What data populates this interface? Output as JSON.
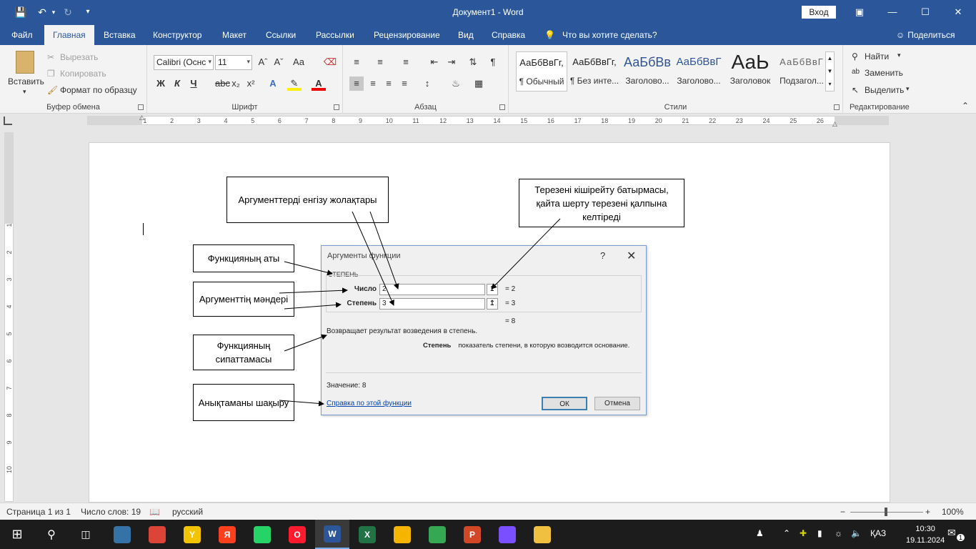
{
  "window": {
    "title": "Документ1 - Word",
    "signin": "Вход",
    "qat": [
      "save-icon",
      "undo-icon",
      "redo-icon",
      "customize-icon"
    ]
  },
  "tabs": [
    "Файл",
    "Главная",
    "Вставка",
    "Конструктор",
    "Макет",
    "Ссылки",
    "Рассылки",
    "Рецензирование",
    "Вид",
    "Справка"
  ],
  "active_tab": "Главная",
  "tellme": "Что вы хотите сделать?",
  "share": "Поделиться",
  "ribbon": {
    "clipboard": {
      "paste": "Вставить",
      "cut": "Вырезать",
      "copy": "Копировать",
      "format_painter": "Формат по образцу",
      "label": "Буфер обмена"
    },
    "font": {
      "name": "Calibri (Оснс",
      "size": "11",
      "label": "Шрифт",
      "bold": "Ж",
      "italic": "К",
      "underline": "Ч",
      "sub": "x₂",
      "sup": "x²",
      "grow": "A^",
      "shrink": "Aˇ",
      "case": "Aa"
    },
    "paragraph": {
      "label": "Абзац",
      "pilcrow": "¶"
    },
    "styles": {
      "label": "Стили",
      "items": [
        {
          "sample": "АаБбВвГг,",
          "name": "¶ Обычный"
        },
        {
          "sample": "АаБбВвГг,",
          "name": "¶ Без инте..."
        },
        {
          "sample": "АаБбВв",
          "name": "Заголово..."
        },
        {
          "sample": "АаБбВвГ",
          "name": "Заголово..."
        },
        {
          "sample": "АаЬ",
          "name": "Заголовок"
        },
        {
          "sample": "АаБбВвГ",
          "name": "Подзагол..."
        }
      ]
    },
    "editing": {
      "find": "Найти",
      "replace": "Заменить",
      "select": "Выделить",
      "label": "Редактирование"
    }
  },
  "ruler": {
    "h_numbers": [
      "2",
      "1",
      "1",
      "2",
      "3",
      "4",
      "5",
      "6",
      "7",
      "8",
      "9",
      "10",
      "11",
      "12",
      "13",
      "14",
      "15",
      "16",
      "17",
      "18",
      "19",
      "20",
      "21",
      "22",
      "23",
      "24",
      "25",
      "26",
      "27"
    ],
    "v_numbers": [
      "3",
      "2",
      "1",
      "1",
      "2",
      "3",
      "4",
      "5",
      "6",
      "7",
      "8",
      "9",
      "10"
    ]
  },
  "dialog": {
    "title": "Аргументы функции",
    "help": "?",
    "close": "✕",
    "function_name": "СТЕПЕНЬ",
    "args": [
      {
        "label": "Число",
        "value": "2",
        "result": "=   2"
      },
      {
        "label": "Степень",
        "value": "3",
        "result": "=   3"
      }
    ],
    "total": "=   8",
    "description": "Возвращает результат возведения в степень.",
    "arg_desc_label": "Степень",
    "arg_desc_text": "показатель степени, в которую возводится основание.",
    "value_line": "Значение:   8",
    "help_link": "Справка по этой функции",
    "ok": "ОК",
    "cancel": "Отмена"
  },
  "annotations": {
    "input_bars": "Аргументтерді енгізу жолақтары",
    "collapse": "Терезені кішірейту батырмасы, қайта шерту терезені қалпына келтіреді",
    "fn_name": "Функцияның аты",
    "arg_values": "Аргументтің мәндері",
    "fn_desc": "Функцияның сипаттамасы",
    "help_call": "Анықтаманы шақыру"
  },
  "status": {
    "page": "Страница 1 из 1",
    "words": "Число слов: 19",
    "lang": "русский",
    "zoom": "100%",
    "zoom_level_percent": 100
  },
  "taskbar": {
    "apps": [
      {
        "name": "python-icon",
        "label": "",
        "color": "#3572a5"
      },
      {
        "name": "chrome-icon",
        "label": "",
        "color": "#db4437"
      },
      {
        "name": "yandex-browser-icon",
        "label": "Y",
        "color": "#f2c500"
      },
      {
        "name": "yandex-icon",
        "label": "Я",
        "color": "#fc3f1d"
      },
      {
        "name": "whatsapp-icon",
        "label": "",
        "color": "#25d366"
      },
      {
        "name": "opera-icon",
        "label": "O",
        "color": "#ff1b2d"
      },
      {
        "name": "word-icon",
        "label": "W",
        "color": "#2b579a"
      },
      {
        "name": "excel-icon",
        "label": "X",
        "color": "#217346"
      },
      {
        "name": "notes-icon",
        "label": "",
        "color": "#f4b400"
      },
      {
        "name": "webdav-icon",
        "label": "",
        "color": "#34a853"
      },
      {
        "name": "powerpoint-icon",
        "label": "P",
        "color": "#d24726"
      },
      {
        "name": "browser-icon",
        "label": "",
        "color": "#7a4fff"
      },
      {
        "name": "file-explorer-icon",
        "label": "",
        "color": "#f0c040"
      }
    ],
    "lang": "ҚАЗ",
    "time": "10:30",
    "date": "19.11.2024",
    "notif_count": "1"
  }
}
